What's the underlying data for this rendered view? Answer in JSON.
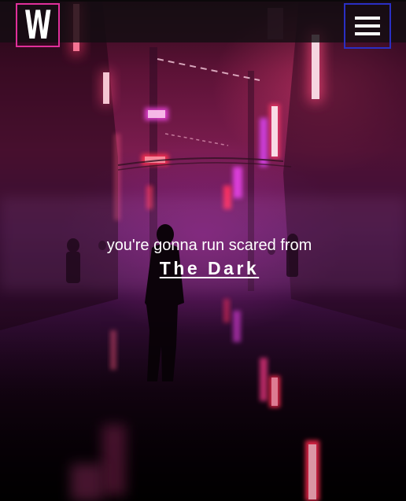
{
  "header": {
    "logo_letter": "W",
    "menu_icon": "hamburger-menu-icon",
    "logo_border_color": "#e0309a",
    "menu_border_color": "#2a2fc4"
  },
  "hero": {
    "tagline": "you're gonna run scared from",
    "title_link": "The Dark"
  },
  "background": {
    "subject": "neon-city-street-silhouette-image"
  }
}
